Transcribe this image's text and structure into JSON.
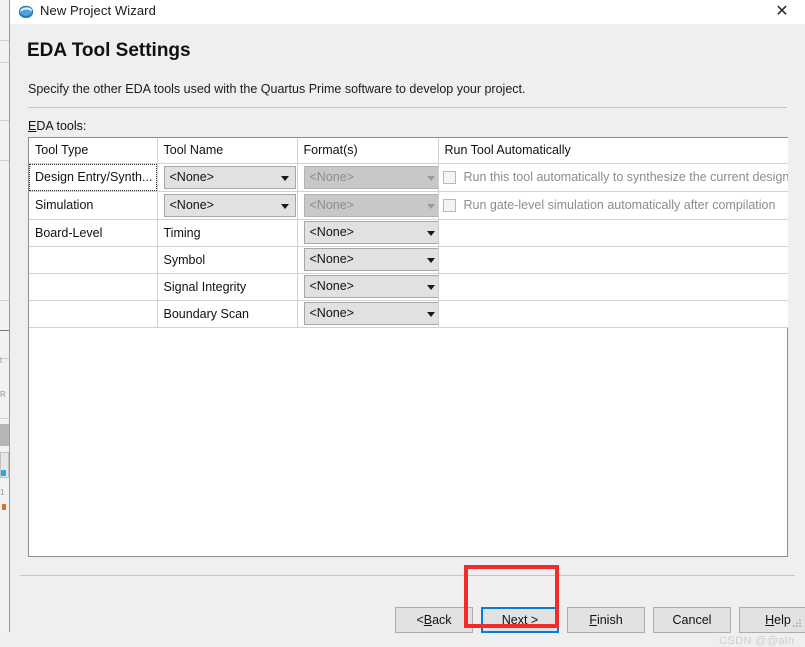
{
  "window": {
    "title": "New Project Wizard",
    "icon": "quartus-globe-icon",
    "close_label": "✕"
  },
  "page": {
    "title": "EDA Tool Settings",
    "description": "Specify the other EDA tools used with the Quartus Prime software to develop your project.",
    "section_label_prefix": "E",
    "section_label_rest": "DA tools:"
  },
  "table": {
    "columns": [
      "Tool Type",
      "Tool Name",
      "Format(s)",
      "Run Tool Automatically"
    ],
    "rows": [
      {
        "tool_type": "Design Entry/Synth...",
        "tool_type_focused": true,
        "tool_name": "<None>",
        "tool_name_control": "combo",
        "tool_name_disabled": false,
        "format": "<None>",
        "format_control": "combo",
        "format_disabled": true,
        "auto_checkbox": true,
        "auto_checked": false,
        "auto_label": "Run this tool automatically to synthesize the current design"
      },
      {
        "tool_type": "Simulation",
        "tool_type_focused": false,
        "tool_name": "<None>",
        "tool_name_control": "combo",
        "tool_name_disabled": false,
        "format": "<None>",
        "format_control": "combo",
        "format_disabled": true,
        "auto_checkbox": true,
        "auto_checked": false,
        "auto_label": "Run gate-level simulation automatically after compilation"
      },
      {
        "tool_type": "Board-Level",
        "tool_type_focused": false,
        "tool_name": "Timing",
        "tool_name_control": "text",
        "tool_name_disabled": false,
        "format": "<None>",
        "format_control": "combo",
        "format_disabled": false,
        "auto_checkbox": false,
        "auto_checked": false,
        "auto_label": ""
      },
      {
        "tool_type": "",
        "tool_type_focused": false,
        "tool_name": "Symbol",
        "tool_name_control": "text",
        "tool_name_disabled": false,
        "format": "<None>",
        "format_control": "combo",
        "format_disabled": false,
        "auto_checkbox": false,
        "auto_checked": false,
        "auto_label": ""
      },
      {
        "tool_type": "",
        "tool_type_focused": false,
        "tool_name": "Signal Integrity",
        "tool_name_control": "text",
        "tool_name_disabled": false,
        "format": "<None>",
        "format_control": "combo",
        "format_disabled": false,
        "auto_checkbox": false,
        "auto_checked": false,
        "auto_label": ""
      },
      {
        "tool_type": "",
        "tool_type_focused": false,
        "tool_name": "Boundary Scan",
        "tool_name_control": "text",
        "tool_name_disabled": false,
        "format": "<None>",
        "format_control": "combo",
        "format_disabled": false,
        "auto_checkbox": false,
        "auto_checked": false,
        "auto_label": ""
      }
    ]
  },
  "buttons": [
    {
      "id": "back",
      "pre": "< ",
      "mn": "B",
      "post": "ack",
      "focused": false
    },
    {
      "id": "next",
      "pre": "",
      "mn": "N",
      "post": "ext >",
      "focused": true
    },
    {
      "id": "finish",
      "pre": "",
      "mn": "F",
      "post": "inish",
      "focused": false
    },
    {
      "id": "cancel",
      "pre": "Cancel",
      "mn": "",
      "post": "",
      "focused": false
    },
    {
      "id": "help",
      "pre": "",
      "mn": "H",
      "post": "elp",
      "focused": false
    }
  ],
  "annotation": {
    "shape": "rectangle",
    "color": "#f22c2c",
    "target": "next-button"
  },
  "watermark": {
    "text": "CSDN @@aln"
  },
  "colors": {
    "dialog_background": "#efefef",
    "titlebar_background": "#ffffff",
    "table_background": "#ffffff",
    "combo_background": "#e1e1e1",
    "combo_disabled_background": "#c8c8c8",
    "focus_blue": "#0a7bd4",
    "annotation_red": "#f22c2c",
    "disabled_text": "#8c8c8c"
  },
  "background_fragments": {
    "labels": [
      "t",
      "R",
      "1"
    ]
  }
}
